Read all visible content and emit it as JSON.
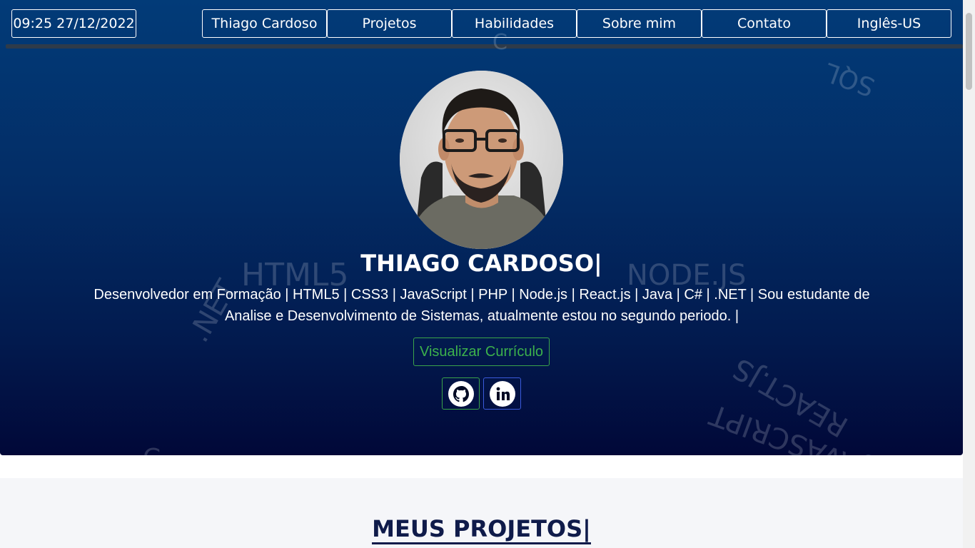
{
  "header": {
    "clock": "09:25 27/12/2022",
    "nav": [
      {
        "label": "Thiago Cardoso"
      },
      {
        "label": "Projetos"
      },
      {
        "label": "Habilidades"
      },
      {
        "label": "Sobre mim"
      },
      {
        "label": "Contato"
      },
      {
        "label": "Inglês-US"
      }
    ]
  },
  "background_words": {
    "html5": "HTML5",
    "node": "NODE.JS",
    "sql": "SQL",
    "net": ".NET",
    "react": "REACT.JS",
    "java": "JAVASCRIPT",
    "top": "C",
    "bottom": "C"
  },
  "hero": {
    "name": "THIAGO CARDOSO",
    "caret": "|",
    "description": "Desenvolvedor em Formação | HTML5 | CSS3 | JavaScript | PHP | Node.js | React.js | Java | C# | .NET | Sou estudante de Analise e Desenvolvimento de Sistemas, atualmente estou no segundo periodo. |",
    "cv_button": "Visualizar Currículo",
    "social": [
      {
        "icon": "github-icon"
      },
      {
        "icon": "linkedin-icon"
      }
    ]
  },
  "projects": {
    "title": "MEUS PROJETOS",
    "caret": "|"
  },
  "colors": {
    "hero_top": "#023b78",
    "hero_bottom": "#010838",
    "accent_green": "#3cb14c",
    "title_navy": "#0f1b4a"
  }
}
